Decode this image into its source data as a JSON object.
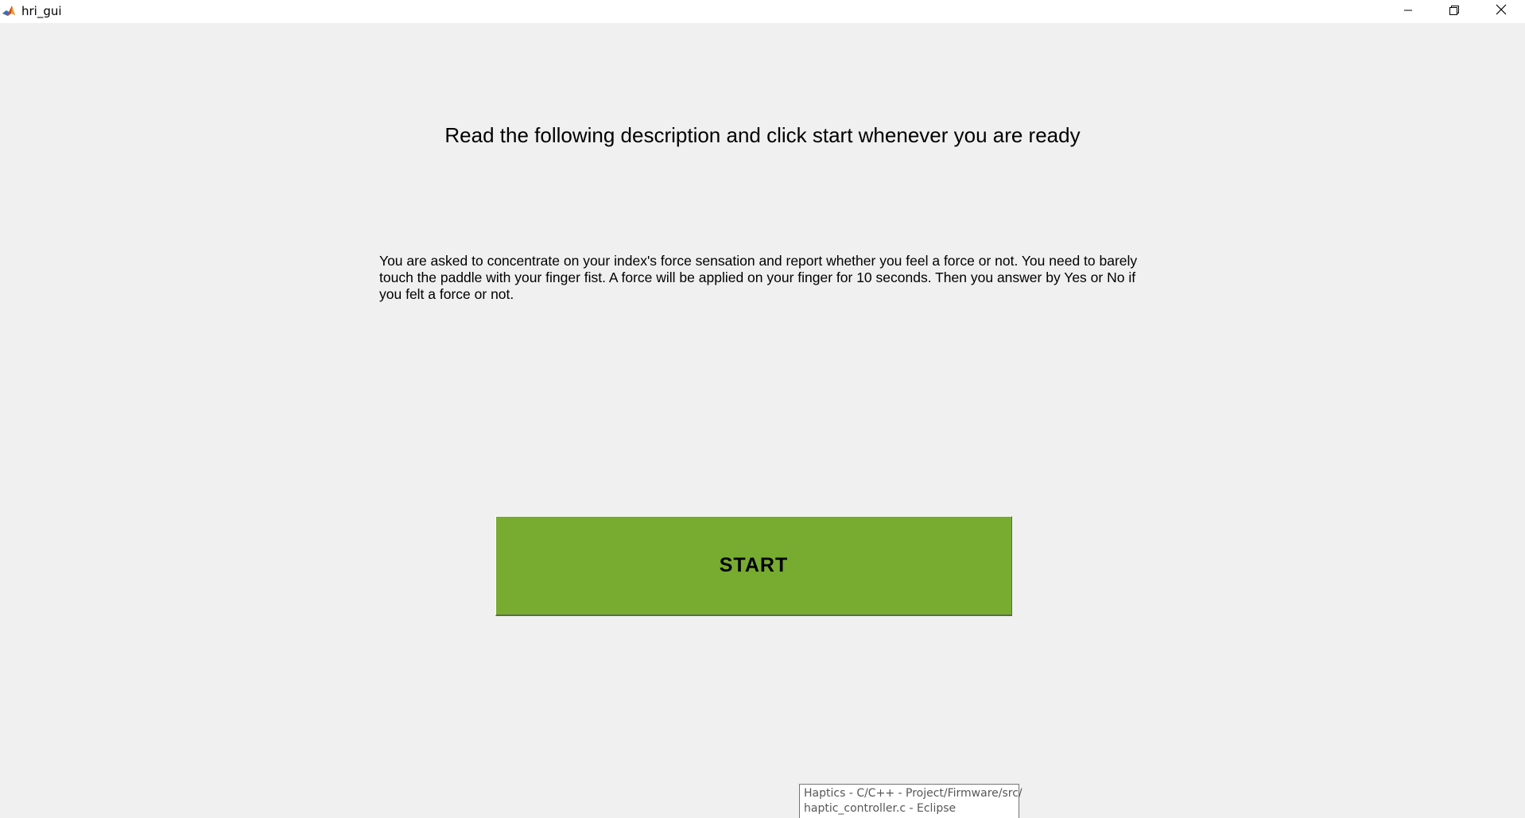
{
  "window": {
    "title": "hri_gui",
    "icon": "matlab-icon",
    "controls": {
      "minimize": "minimize-icon",
      "restore": "restore-icon",
      "close": "close-icon"
    }
  },
  "main": {
    "heading": "Read the following description and click start whenever you are ready",
    "description": "You are asked to concentrate on your index's force sensation and report whether you feel a force or not. You need to barely touch the paddle with your finger fist. A force will be applied on your finger for 10 seconds. Then you answer by Yes or No if you felt a force or not.",
    "start_label": "START",
    "start_color": "#77ac30"
  },
  "tooltip": {
    "line1": "Haptics - C/C++ - Project/Firmware/src/",
    "line2": "haptic_controller.c - Eclipse"
  }
}
